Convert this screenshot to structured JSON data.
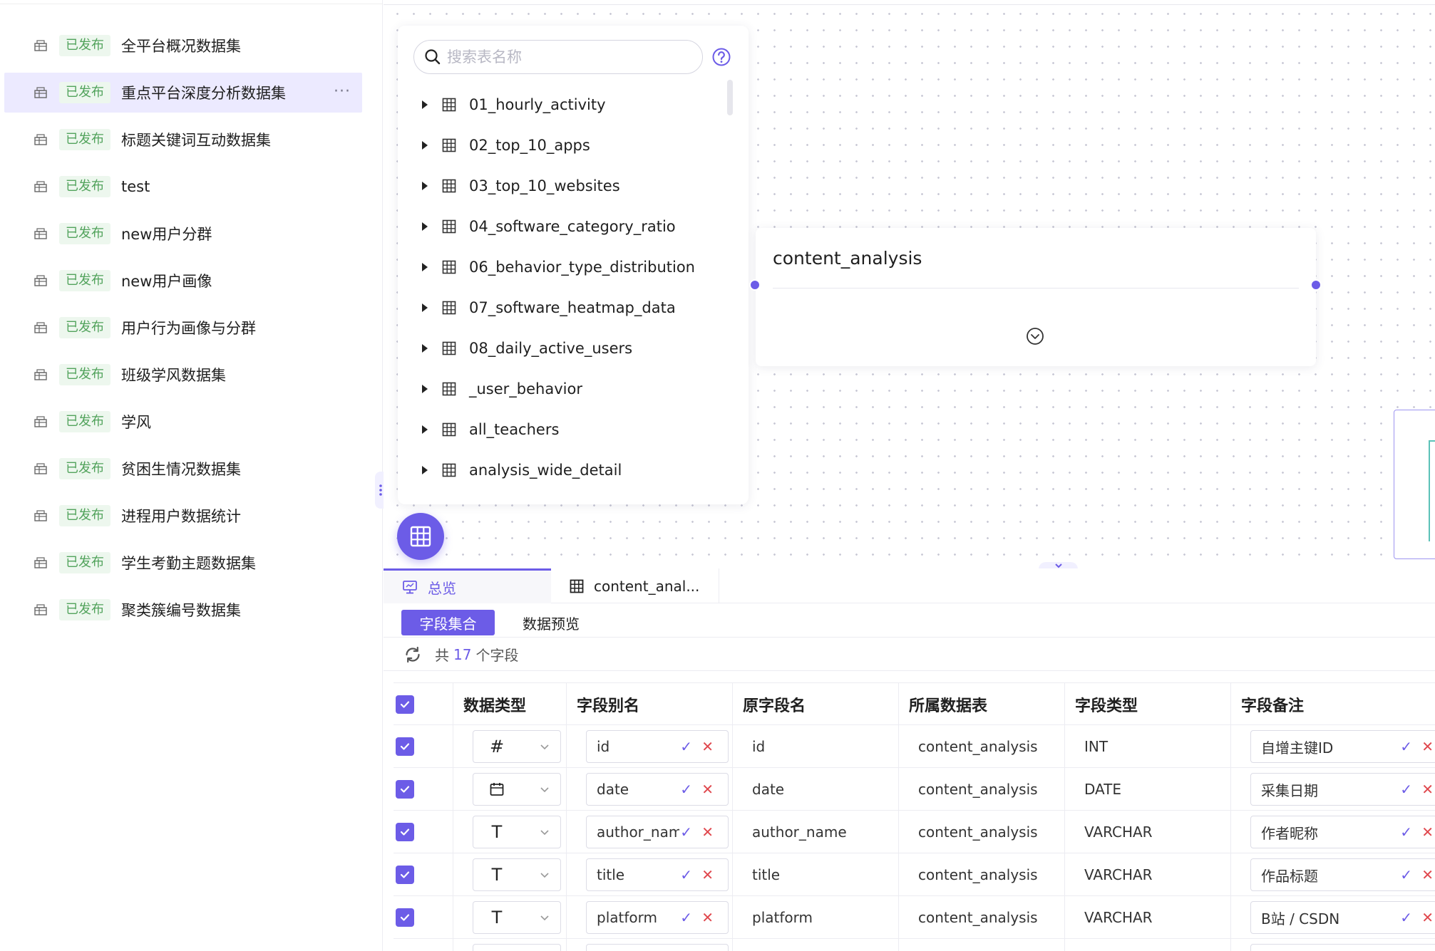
{
  "sidebar": {
    "datasets": [
      {
        "status": "已发布",
        "name": "全平台概况数据集"
      },
      {
        "status": "已发布",
        "name": "重点平台深度分析数据集",
        "active": true
      },
      {
        "status": "已发布",
        "name": "标题关键词互动数据集"
      },
      {
        "status": "已发布",
        "name": "test"
      },
      {
        "status": "已发布",
        "name": "new用户分群"
      },
      {
        "status": "已发布",
        "name": "new用户画像"
      },
      {
        "status": "已发布",
        "name": "用户行为画像与分群"
      },
      {
        "status": "已发布",
        "name": "班级学风数据集"
      },
      {
        "status": "已发布",
        "name": "学风"
      },
      {
        "status": "已发布",
        "name": "贫困生情况数据集"
      },
      {
        "status": "已发布",
        "name": "进程用户数据统计"
      },
      {
        "status": "已发布",
        "name": "学生考勤主题数据集"
      },
      {
        "status": "已发布",
        "name": "聚类簇编号数据集"
      }
    ],
    "more_label": "···"
  },
  "table_panel": {
    "search_placeholder": "搜索表名称",
    "tables": [
      "01_hourly_activity",
      "02_top_10_apps",
      "03_top_10_websites",
      "04_software_category_ratio",
      "06_behavior_type_distribution",
      "07_software_heatmap_data",
      "08_daily_active_users",
      "_user_behavior",
      "all_teachers",
      "analysis_wide_detail"
    ]
  },
  "node": {
    "title": "content_analysis"
  },
  "bottom": {
    "tabs": [
      "总览",
      "content_anal..."
    ],
    "subtabs": {
      "active": "字段集合",
      "other": "数据预览"
    },
    "count": {
      "prefix": "共",
      "value": "17",
      "suffix": "个字段"
    },
    "columns": [
      "数据类型",
      "字段别名",
      "原字段名",
      "所属数据表",
      "字段类型",
      "字段备注"
    ],
    "rows": [
      {
        "type_icon": "#",
        "alias": "id",
        "original": "id",
        "table": "content_analysis",
        "field_type": "INT",
        "remark": "自增主键ID"
      },
      {
        "type_icon": "calendar",
        "alias": "date",
        "original": "date",
        "table": "content_analysis",
        "field_type": "DATE",
        "remark": "采集日期"
      },
      {
        "type_icon": "T",
        "alias": "author_name",
        "original": "author_name",
        "table": "content_analysis",
        "field_type": "VARCHAR",
        "remark": "作者昵称"
      },
      {
        "type_icon": "T",
        "alias": "title",
        "original": "title",
        "table": "content_analysis",
        "field_type": "VARCHAR",
        "remark": "作品标题"
      },
      {
        "type_icon": "T",
        "alias": "platform",
        "original": "platform",
        "table": "content_analysis",
        "field_type": "VARCHAR",
        "remark": "B站 / CSDN"
      }
    ]
  },
  "colors": {
    "accent": "#6c5ce7",
    "badge_text": "#52a35c",
    "badge_bg": "#edf7ee",
    "danger": "#e0484e"
  }
}
